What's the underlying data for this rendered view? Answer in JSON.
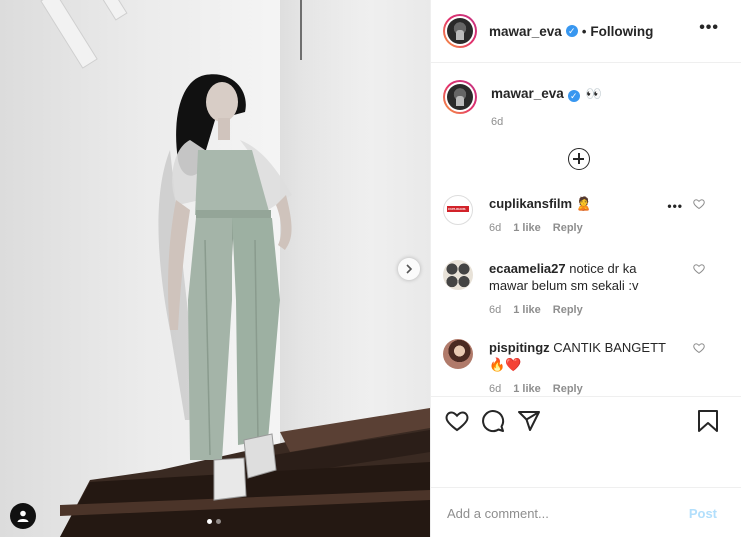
{
  "post": {
    "author": "mawar_eva",
    "follow_status": "Following",
    "separator": "•",
    "more_glyph": "•••",
    "verified_glyph": "✓"
  },
  "caption": {
    "username": "mawar_eva",
    "text": "👀",
    "time": "6d"
  },
  "comments": [
    {
      "username": "cuplikansfilm",
      "text": "🙎",
      "time": "6d",
      "likes": "1 like",
      "reply": "Reply",
      "avatar": "cuplikansfilm-logo",
      "avatar_text": "CUPLIKANS"
    },
    {
      "username": "ecaamelia27",
      "text": "notice dr ka mawar belum sm sekali :v",
      "time": "6d",
      "likes": "1 like",
      "reply": "Reply",
      "avatar": "grid-photo"
    },
    {
      "username": "pispitingz",
      "text": "CANTIK BANGETT🔥❤️",
      "time": "6d",
      "likes": "1 like",
      "reply": "Reply",
      "avatar": "portrait-photo"
    }
  ],
  "add_comment": {
    "placeholder": "Add a comment...",
    "post_label": "Post"
  },
  "carousel": {
    "slide_count": 2,
    "active_slide": 1
  },
  "icons": {
    "like": "heart-icon",
    "comment": "comment-bubble-icon",
    "share": "paper-plane-icon",
    "save": "bookmark-icon",
    "load_more": "plus-circle-icon",
    "next": "chevron-right-icon",
    "tags": "user-tag-icon"
  },
  "colors": {
    "verified": "#3897f0",
    "post_disabled": "#b2dffc",
    "story_ring_start": "#f9a03f",
    "story_ring_end": "#c13584",
    "meta_gray": "#8e8e8e"
  }
}
